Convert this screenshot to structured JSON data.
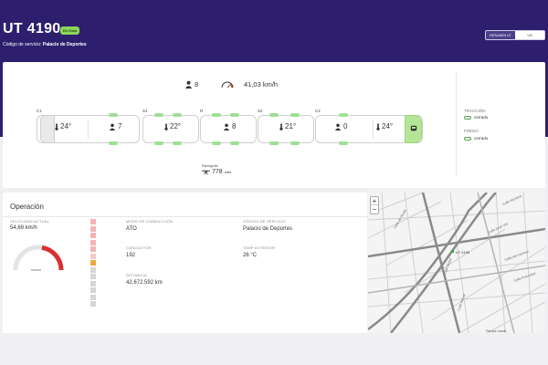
{
  "header": {
    "unit_title": "UT 4190",
    "status_badge": "En línea",
    "service_label": "Código de servicio:",
    "service_value": "Palacio de Deportes",
    "tabs": [
      {
        "label": "RESUMEN UT",
        "active": true
      },
      {
        "label": "VM",
        "active": false
      }
    ]
  },
  "train": {
    "passenger_count": "8",
    "speed": "41,03 km/h",
    "car_labels": [
      "C1",
      "S1",
      "R",
      "S2",
      "C2"
    ],
    "cells": [
      {
        "icon": "thermometer-icon",
        "value": "24°"
      },
      {
        "icon": "person-icon",
        "value": "7"
      },
      {
        "icon": "thermometer-icon",
        "value": "22°"
      },
      {
        "icon": "person-icon",
        "value": "8"
      },
      {
        "icon": "thermometer-icon",
        "value": "21°"
      },
      {
        "icon": "person-icon",
        "value": "0"
      },
      {
        "icon": "thermometer-icon",
        "value": "24°"
      }
    ],
    "pantograph_label": "Pantógrafo",
    "pantograph_value": "778",
    "pantograph_unit": "volts"
  },
  "side": {
    "traction_title": "TRACCIÓN",
    "traction_value": "cerrado",
    "brake_title": "FRENO",
    "brake_value": "cerrado"
  },
  "operation": {
    "title": "Operación",
    "speed_label": "VELOCIDAD ACTUAL",
    "speed_value": "54,69 km/h",
    "mode_label": "MODO DE CONDUCCIÓN",
    "mode_value": "ATO",
    "driver_label": "CONDUCTOR",
    "driver_value": "192",
    "distance_label": "DISTANCIA",
    "distance_value": "42.672.592 km",
    "service_code_label": "CÓDIGO DE SERVICIO",
    "service_code_value": "Palacio de Deportes",
    "temp_label": "TEMP EXTERIOR",
    "temp_value": "26 °C",
    "gauge_fraction": 0.55,
    "level_colors": [
      "#f4b4b4",
      "#f4b4b4",
      "#f4b4b4",
      "#f4b4b4",
      "#f4b4b4",
      "#f4c8c8",
      "#f0a640",
      "#d6d6d6",
      "#d6d6d6",
      "#d6d6d6",
      "#d6d6d6",
      "#d6d6d6",
      "#d6d6d6"
    ]
  },
  "map": {
    "zoom_in": "+",
    "zoom_out": "−",
    "train_marker": "UT 4190",
    "streets": [
      "Calle Montera",
      "Calle Gran Vía",
      "Calle de Alcalá",
      "Calle Mayor",
      "Calle del Carmen",
      "Calle Preciados",
      "Calle Arenal"
    ],
    "attribution": "Parque Lineal"
  }
}
